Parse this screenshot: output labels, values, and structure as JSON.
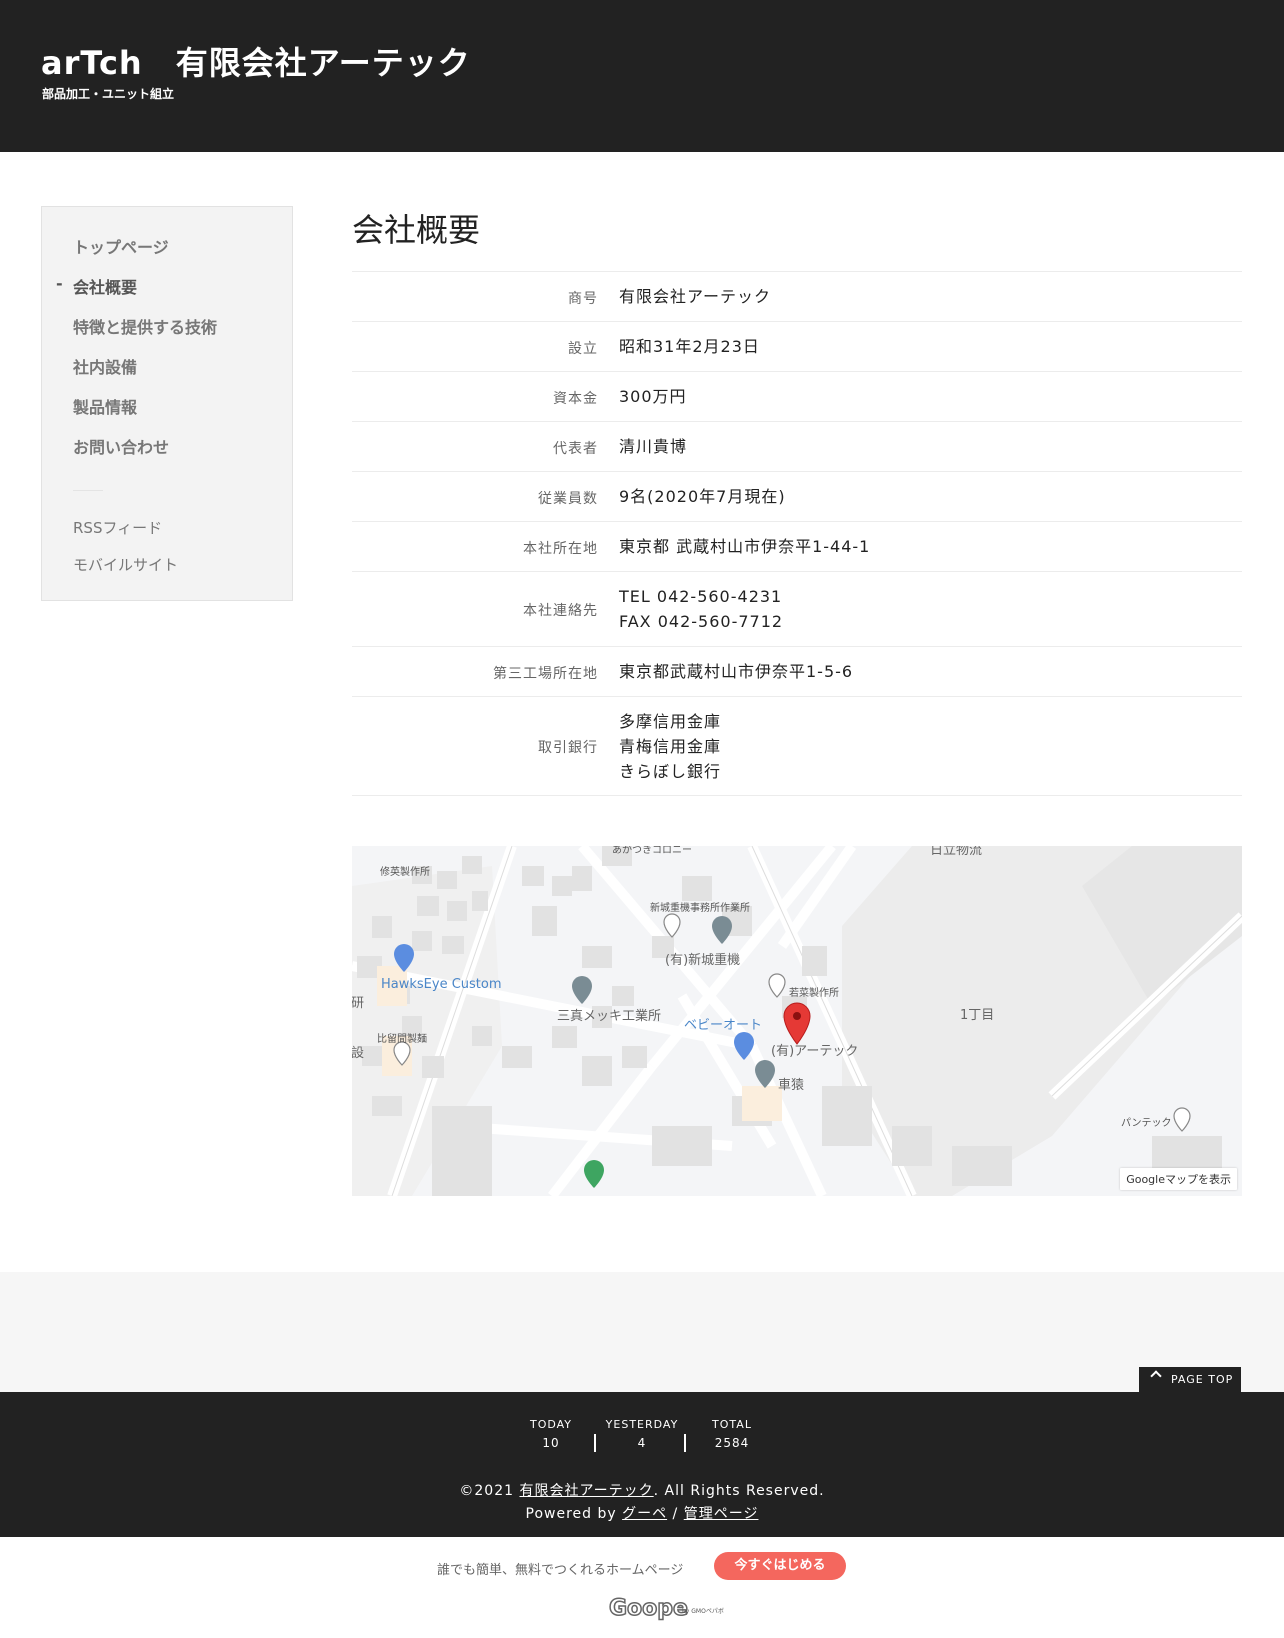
{
  "header": {
    "title": "arTch　有限会社アーテック",
    "subtitle": "部品加工・ユニット組立"
  },
  "sidebar": {
    "active_marker": "-",
    "items": [
      {
        "label": "トップページ"
      },
      {
        "label": "会社概要",
        "active": true
      },
      {
        "label": "特徴と提供する技術"
      },
      {
        "label": "社内設備"
      },
      {
        "label": "製品情報"
      },
      {
        "label": "お問い合わせ"
      }
    ],
    "sub_items": [
      {
        "label": "RSSフィード"
      },
      {
        "label": "モバイルサイト"
      }
    ]
  },
  "main": {
    "title": "会社概要",
    "rows": [
      {
        "label": "商号",
        "lines": [
          "有限会社アーテック"
        ]
      },
      {
        "label": "設立",
        "lines": [
          "昭和31年2月23日"
        ]
      },
      {
        "label": "資本金",
        "lines": [
          "300万円"
        ]
      },
      {
        "label": "代表者",
        "lines": [
          "清川貴博"
        ]
      },
      {
        "label": "従業員数",
        "lines": [
          "9名(2020年7月現在)"
        ]
      },
      {
        "label": "本社所在地",
        "lines": [
          "東京都 武蔵村山市伊奈平1-44-1"
        ]
      },
      {
        "label": "本社連絡先",
        "lines": [
          "TEL 042-560-4231",
          "FAX 042-560-7712"
        ]
      },
      {
        "label": "第三工場所在地",
        "lines": [
          "東京都武蔵村山市伊奈平1-5-6"
        ]
      },
      {
        "label": "取引銀行",
        "lines": [
          "多摩信用金庫",
          "青梅信用金庫",
          "きらぼし銀行"
        ]
      }
    ]
  },
  "map": {
    "labels": {
      "shuei": "修英製作所",
      "akatsuki": "あかつきコロニー",
      "shinjo_office": "新城重機事務所作業所",
      "shinjo": "(有)新城重機",
      "wakana": "若菜製作所",
      "hawkseye": "HawksEye Custom",
      "sanshin": "三真メッキ工業所",
      "baby_auto": "ベビーオート",
      "artech": "(有)アーテック",
      "kurumazaru": "車猿",
      "hiruma": "比留間製麺",
      "chome": "1丁目",
      "pantec": "パンテック",
      "hitachi": "日立物流",
      "edge_left1": "研",
      "edge_left2": "設"
    },
    "view_button": "Googleマップを表示"
  },
  "footer": {
    "page_top": "PAGE TOP",
    "counters": [
      {
        "label": "TODAY",
        "value": "10"
      },
      {
        "label": "YESTERDAY",
        "value": "4"
      },
      {
        "label": "TOTAL",
        "value": "2584"
      }
    ],
    "copyright_prefix": "©2021 ",
    "copyright_link": "有限会社アーテック",
    "copyright_suffix": ". All Rights Reserved.",
    "powered_prefix": "Powered by ",
    "powered_link": "グーペ",
    "powered_sep": " / ",
    "admin_link": "管理ページ"
  },
  "ad": {
    "text": "誰でも簡単、無料でつくれるホームページ",
    "button": "今すぐはじめる",
    "logo_text": "Goope",
    "logo_sub": "by GMOペパボ"
  },
  "colors": {
    "header_bg": "#222222",
    "footer_bg": "#222222",
    "accent_button": "#f4675e",
    "map_pin_red": "#e53935",
    "map_link_blue": "#4a86c8"
  }
}
